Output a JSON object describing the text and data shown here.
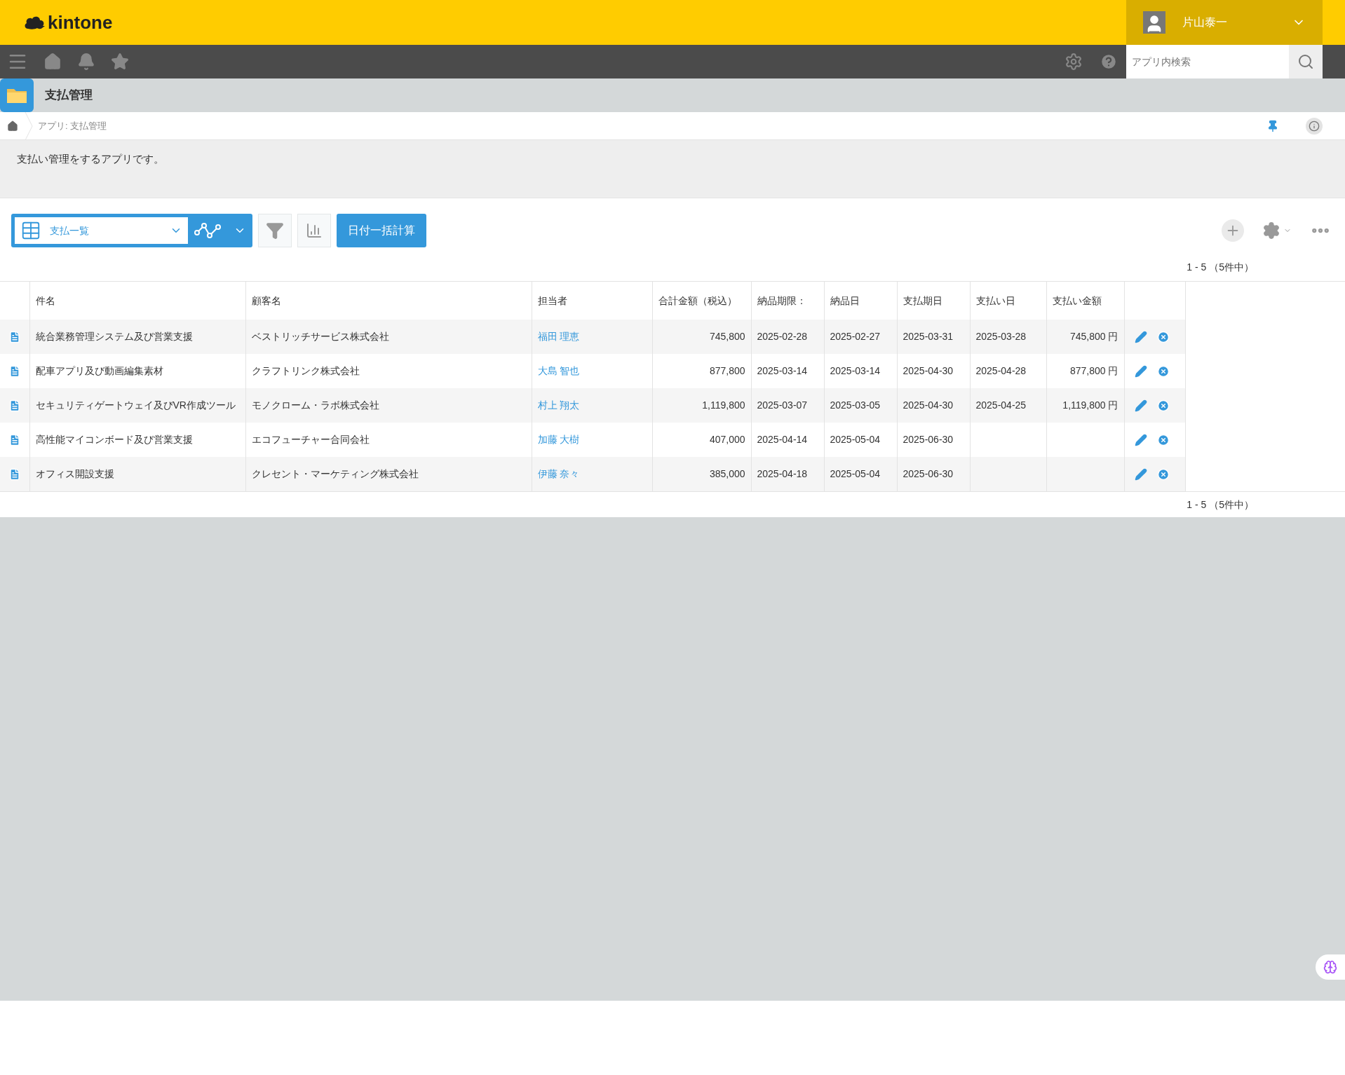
{
  "header": {
    "logo": "kintone",
    "user_name": "片山泰一"
  },
  "search": {
    "placeholder": "アプリ内検索"
  },
  "app": {
    "title": "支払管理"
  },
  "breadcrumb": {
    "text": "アプリ: 支払管理"
  },
  "description": "支払い管理をするアプリです。",
  "toolbar": {
    "view_name": "支払一覧",
    "action_button": "日付一括計算"
  },
  "pagination_top": "1 - 5 （5件中）",
  "table": {
    "columns": [
      "件名",
      "顧客名",
      "担当者",
      "合計金額（税込）",
      "納品期限：",
      "納品日",
      "支払期日",
      "支払い日",
      "支払い金額"
    ],
    "rows": [
      {
        "cells": [
          "統合業務管理システム及び営業支援",
          "ベストリッチサービス株式会社",
          "福田 理恵",
          "745,800",
          "2025-02-28",
          "2025-02-27",
          "2025-03-31",
          "2025-03-28",
          "745,800 円"
        ]
      },
      {
        "cells": [
          "配車アプリ及び動画編集素材",
          "クラフトリンク株式会社",
          "大島 智也",
          "877,800",
          "2025-03-14",
          "2025-03-14",
          "2025-04-30",
          "2025-04-28",
          "877,800 円"
        ]
      },
      {
        "cells": [
          "セキュリティゲートウェイ及びVR作成ツール",
          "モノクローム・ラボ株式会社",
          "村上 翔太",
          "1,119,800",
          "2025-03-07",
          "2025-03-05",
          "2025-04-30",
          "2025-04-25",
          "1,119,800 円"
        ]
      },
      {
        "cells": [
          "高性能マイコンボード及び営業支援",
          "エコフューチャー合同会社",
          "加藤 大樹",
          "407,000",
          "2025-04-14",
          "2025-05-04",
          "2025-06-30",
          null,
          null
        ]
      },
      {
        "cells": [
          "オフィス開設支援",
          "クレセント・マーケティング株式会社",
          "伊藤 奈々",
          "385,000",
          "2025-04-18",
          "2025-05-04",
          "2025-06-30",
          null,
          null
        ]
      }
    ]
  },
  "pagination_bottom": "1 - 5 （5件中）"
}
